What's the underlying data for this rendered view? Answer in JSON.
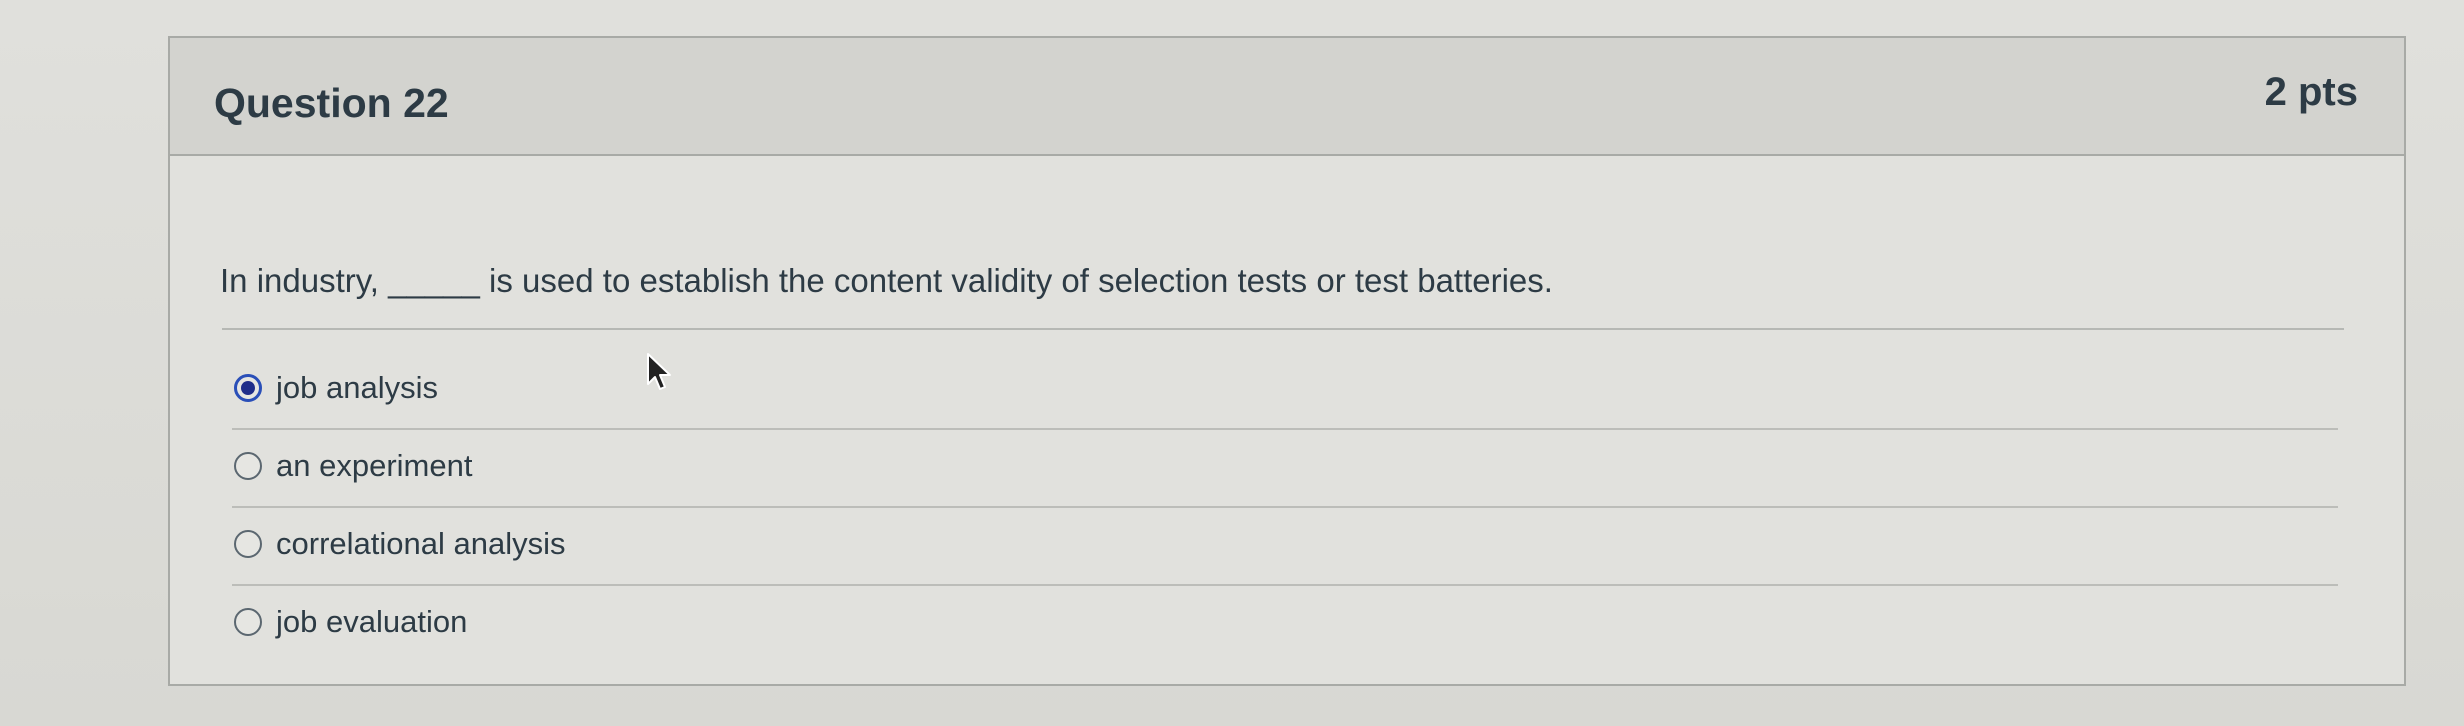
{
  "question": {
    "title": "Question 22",
    "points": "2 pts",
    "text": "In industry, _____ is used to establish the content validity of selection tests or test batteries."
  },
  "answers": [
    {
      "label": "job analysis",
      "selected": true
    },
    {
      "label": "an experiment",
      "selected": false
    },
    {
      "label": "correlational analysis",
      "selected": false
    },
    {
      "label": "job evaluation",
      "selected": false
    }
  ],
  "icons": {
    "cursor": "mouse-pointer-icon"
  },
  "colors": {
    "selected_radio": "#1f2d8a",
    "text": "#2d3b45"
  }
}
